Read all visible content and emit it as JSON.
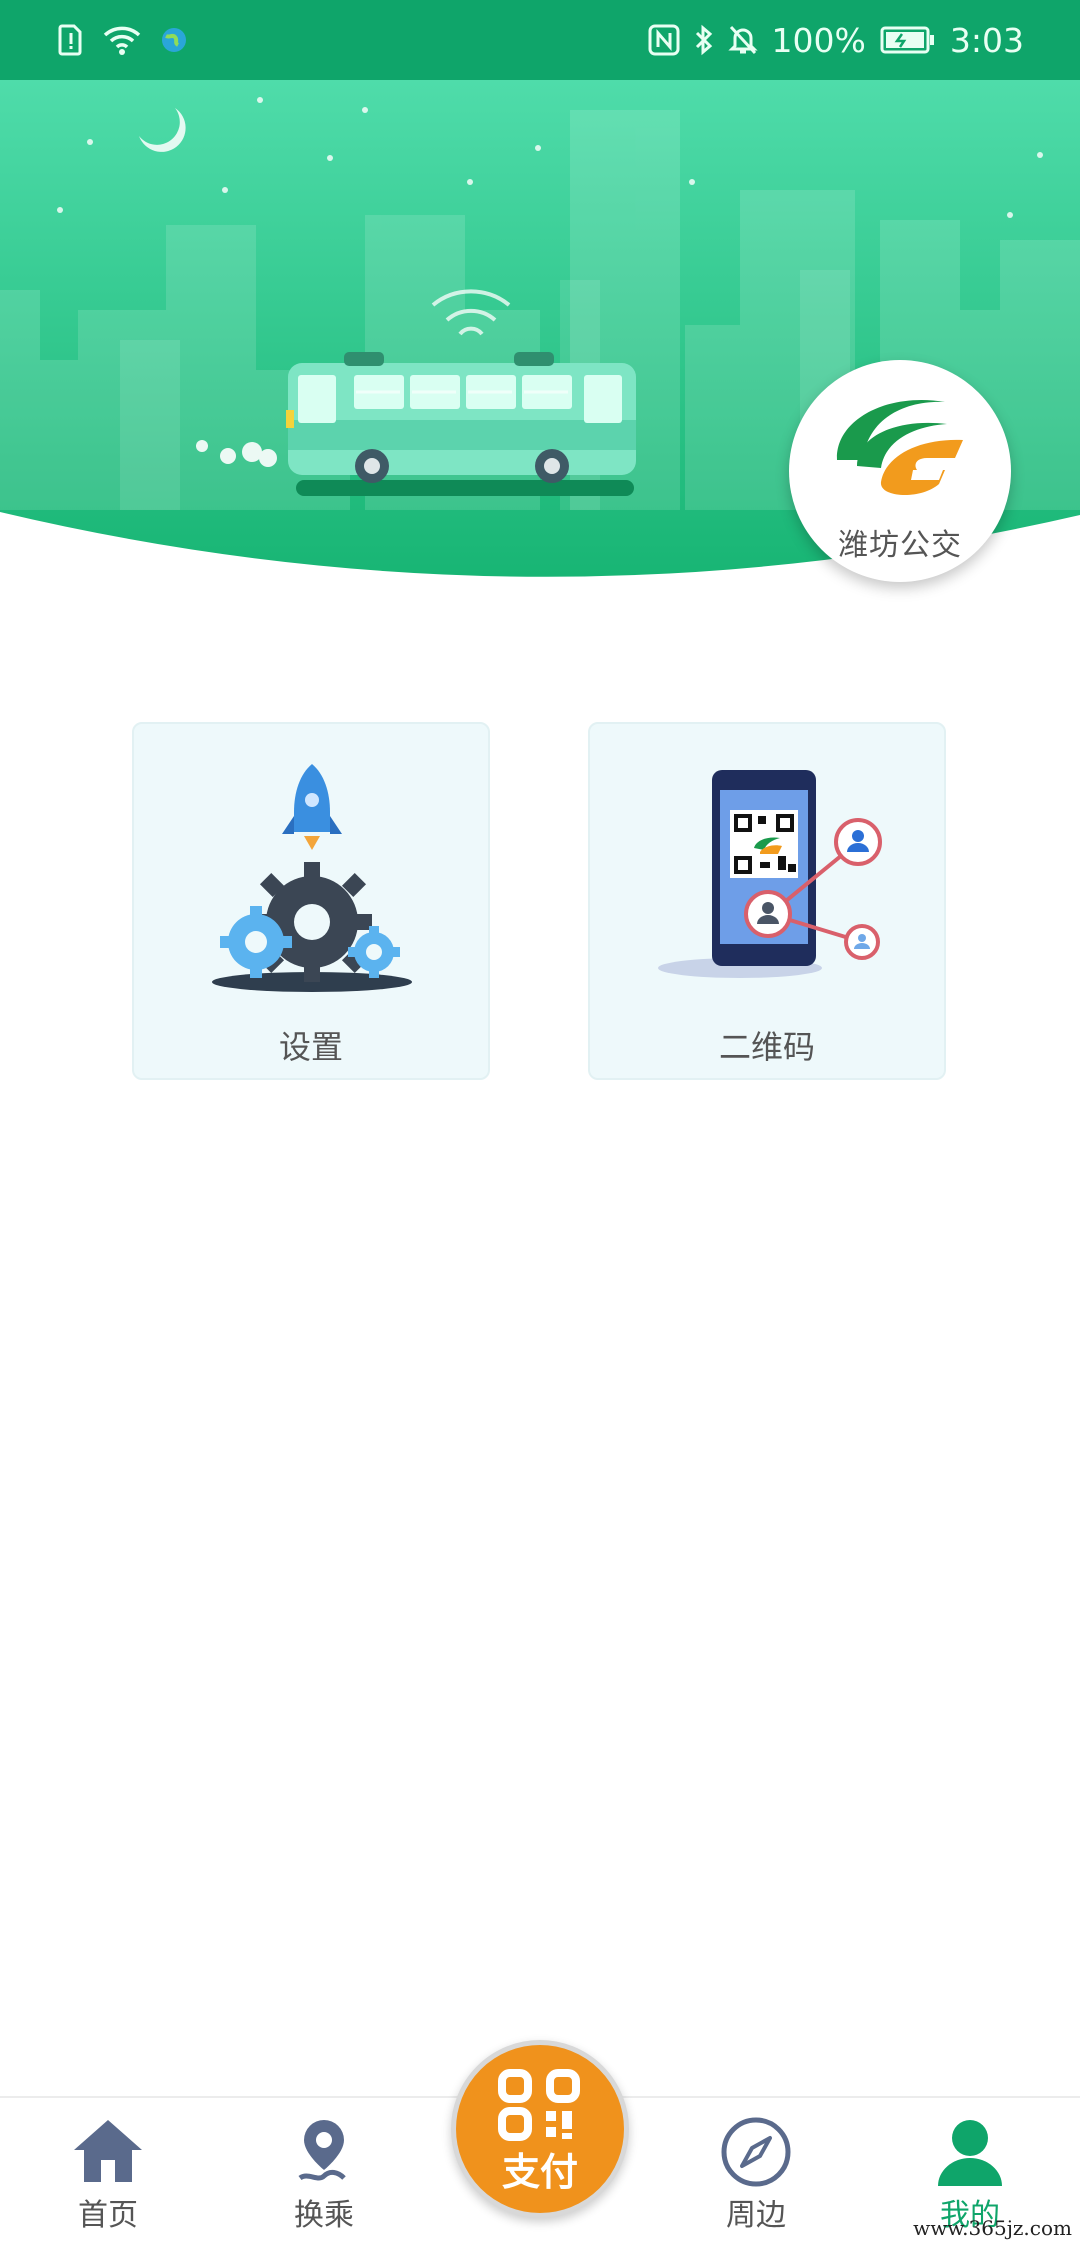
{
  "status_bar": {
    "battery": "100%",
    "time": "3:03"
  },
  "brand": {
    "logo_text": "潍坊公交",
    "primary_color": "#0fa56a",
    "accent_color": "#f0921c"
  },
  "cards": [
    {
      "label": "设置",
      "icon": "gear-rocket-icon"
    },
    {
      "label": "二维码",
      "icon": "phone-qr-icon"
    }
  ],
  "bottom_nav": {
    "items": [
      {
        "label": "首页",
        "icon": "home-icon",
        "active": false
      },
      {
        "label": "换乘",
        "icon": "route-pin-icon",
        "active": false
      },
      {
        "label": "周边",
        "icon": "compass-icon",
        "active": false
      },
      {
        "label": "我的",
        "icon": "user-icon",
        "active": true
      }
    ],
    "pay_label": "支付"
  },
  "watermark": "www.365jz.com"
}
